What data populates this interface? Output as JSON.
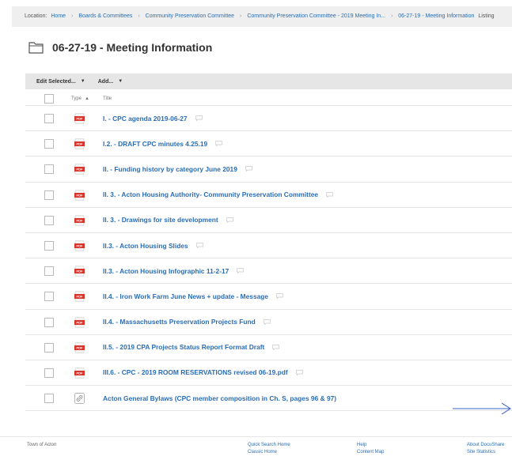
{
  "breadcrumb": {
    "label": "Location:",
    "items": [
      "Home",
      "Boards & Committees",
      "Community Preservation Committee",
      "Community Preservation Committee - 2019 Meeting In...",
      "06-27-19 - Meeting Information"
    ],
    "suffix": "Listing"
  },
  "page": {
    "title": "06-27-19 - Meeting Information"
  },
  "toolbar": {
    "edit_selected": "Edit Selected...",
    "add": "Add..."
  },
  "list": {
    "header": {
      "type": "Type",
      "sort_indicator": "▲",
      "title": "Title"
    },
    "items": [
      {
        "title": "I. - CPC agenda 2019-06-27",
        "type": "pdf"
      },
      {
        "title": "I.2. - DRAFT CPC minutes 4.25.19",
        "type": "pdf"
      },
      {
        "title": "II. - Funding history by category June 2019",
        "type": "pdf"
      },
      {
        "title": "II. 3. - Acton Housing Authority- Community Preservation Committee",
        "type": "pdf"
      },
      {
        "title": "II. 3. - Drawings for site development",
        "type": "pdf"
      },
      {
        "title": "II.3. - Acton Housing Slides",
        "type": "pdf"
      },
      {
        "title": "II.3. - Acton Housing Infographic 11-2-17",
        "type": "pdf"
      },
      {
        "title": "II.4. - Iron Work Farm June News + update - Message",
        "type": "pdf"
      },
      {
        "title": "II.4. - Massachusetts Preservation Projects Fund",
        "type": "pdf"
      },
      {
        "title": "II.5. - 2019 CPA Projects Status Report Format Draft",
        "type": "pdf"
      },
      {
        "title": "III.6. - CPC - 2019 ROOM RESERVATIONS revised 06-19.pdf",
        "type": "pdf"
      },
      {
        "title": "Acton General Bylaws (CPC member composition in Ch. S, pages 96 & 97)",
        "type": "link"
      }
    ]
  },
  "footer": {
    "org": "Town of Acton",
    "quick_search_home": "Quick Search Home",
    "classic_home": "Classic Home",
    "help": "Help",
    "content_map": "Content Map",
    "about": "About DocuShare",
    "site_statistics": "Site Statistics"
  },
  "colors": {
    "link": "#2a6db5",
    "pdf_icon": "#d9342b",
    "arrow": "#3a63c8"
  }
}
